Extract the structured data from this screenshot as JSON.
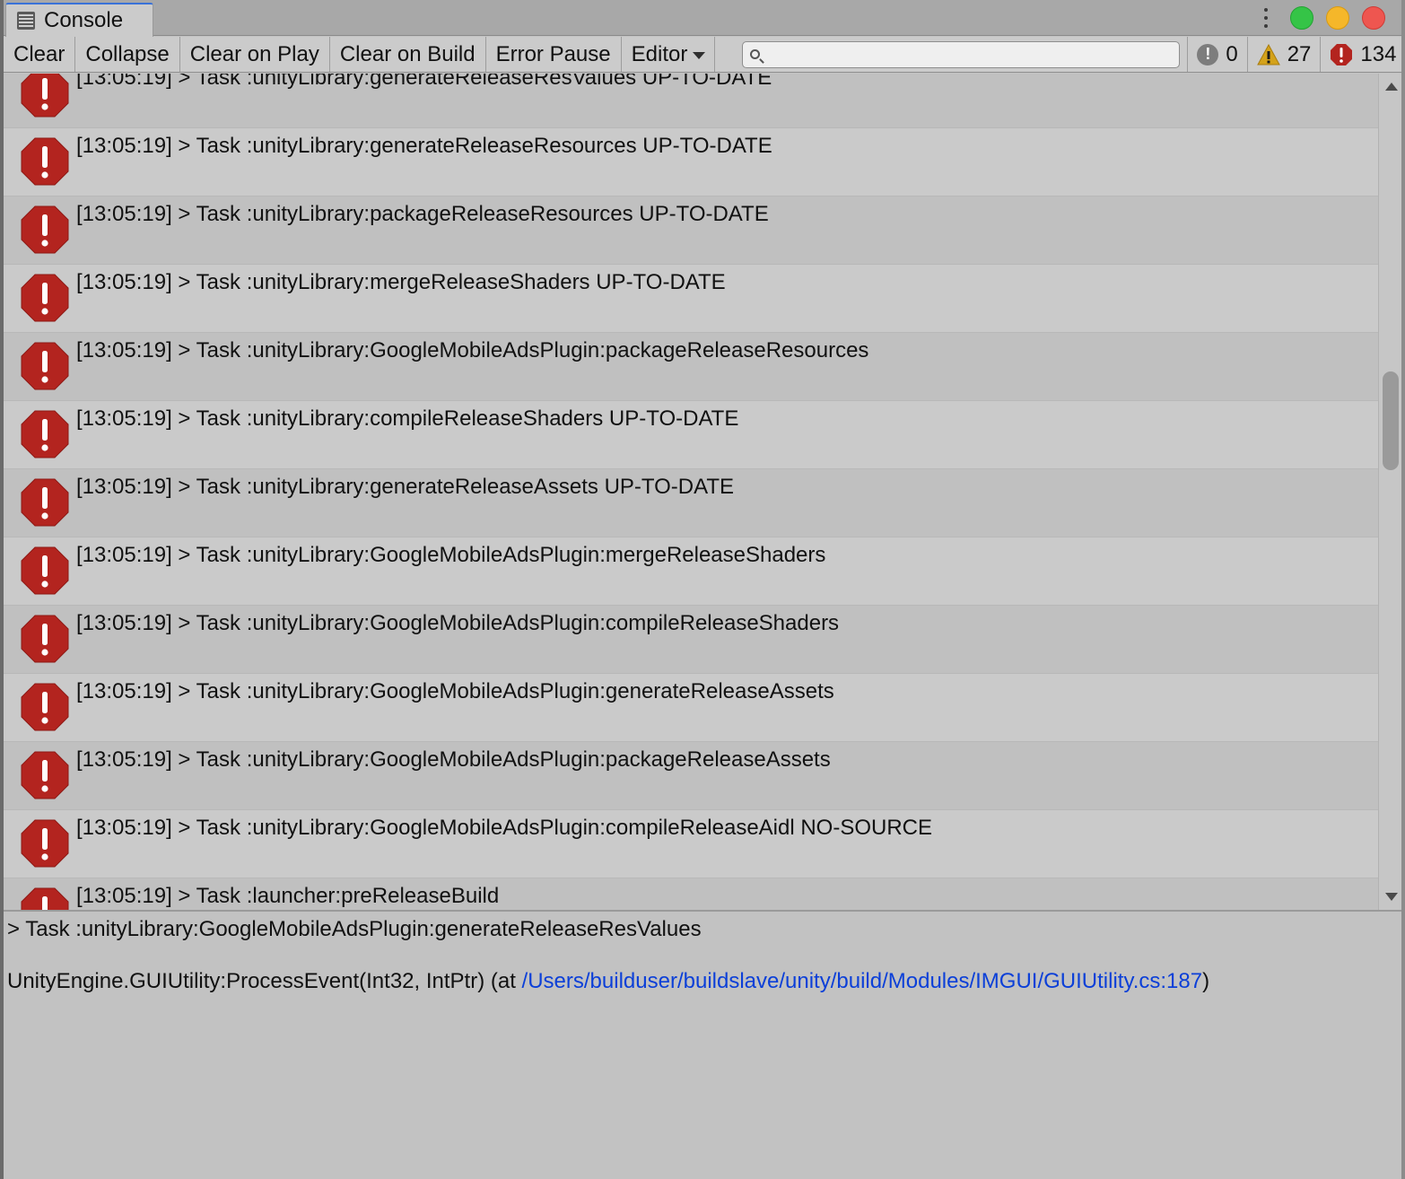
{
  "window": {
    "tab_title": "Console",
    "tab_icon": "console-list-icon",
    "controls": [
      "more-options-icon",
      "zoom-button",
      "minimize-button",
      "close-button"
    ]
  },
  "toolbar": {
    "clear": "Clear",
    "collapse": "Collapse",
    "clear_on_play": "Clear on Play",
    "clear_on_build": "Clear on Build",
    "error_pause": "Error Pause",
    "editor": "Editor",
    "search_value": "",
    "counters": {
      "info": "0",
      "warnings": "27",
      "errors": "134"
    }
  },
  "log": {
    "rows": [
      {
        "text": "[13:05:19] > Task :unityLibrary:generateReleaseResValues UP-TO-DATE",
        "type": "error"
      },
      {
        "text": "[13:05:19] > Task :unityLibrary:generateReleaseResources UP-TO-DATE",
        "type": "error"
      },
      {
        "text": "[13:05:19] > Task :unityLibrary:packageReleaseResources UP-TO-DATE",
        "type": "error"
      },
      {
        "text": "[13:05:19] > Task :unityLibrary:mergeReleaseShaders UP-TO-DATE",
        "type": "error"
      },
      {
        "text": "[13:05:19] > Task :unityLibrary:GoogleMobileAdsPlugin:packageReleaseResources",
        "type": "error"
      },
      {
        "text": "[13:05:19] > Task :unityLibrary:compileReleaseShaders UP-TO-DATE",
        "type": "error"
      },
      {
        "text": "[13:05:19] > Task :unityLibrary:generateReleaseAssets UP-TO-DATE",
        "type": "error"
      },
      {
        "text": "[13:05:19] > Task :unityLibrary:GoogleMobileAdsPlugin:mergeReleaseShaders",
        "type": "error"
      },
      {
        "text": "[13:05:19] > Task :unityLibrary:GoogleMobileAdsPlugin:compileReleaseShaders",
        "type": "error"
      },
      {
        "text": "[13:05:19] > Task :unityLibrary:GoogleMobileAdsPlugin:generateReleaseAssets",
        "type": "error"
      },
      {
        "text": "[13:05:19] > Task :unityLibrary:GoogleMobileAdsPlugin:packageReleaseAssets",
        "type": "error"
      },
      {
        "text": "[13:05:19] > Task :unityLibrary:GoogleMobileAdsPlugin:compileReleaseAidl NO-SOURCE",
        "type": "error"
      },
      {
        "text": "[13:05:19] > Task :launcher:preReleaseBuild",
        "type": "error"
      }
    ]
  },
  "detail": {
    "line1": "> Task :unityLibrary:GoogleMobileAdsPlugin:generateReleaseResValues",
    "stack_prefix": "UnityEngine.GUIUtility:ProcessEvent(Int32, IntPtr) (at ",
    "stack_link": "/Users/builduser/buildslave/unity/build/Modules/IMGUI/GUIUtility.cs:187",
    "stack_suffix": ")"
  },
  "colors": {
    "error_icon": "#b3241f",
    "warning_icon": "#d4a21a",
    "link": "#0b3fd8",
    "tab_accent": "#3a72d8"
  }
}
